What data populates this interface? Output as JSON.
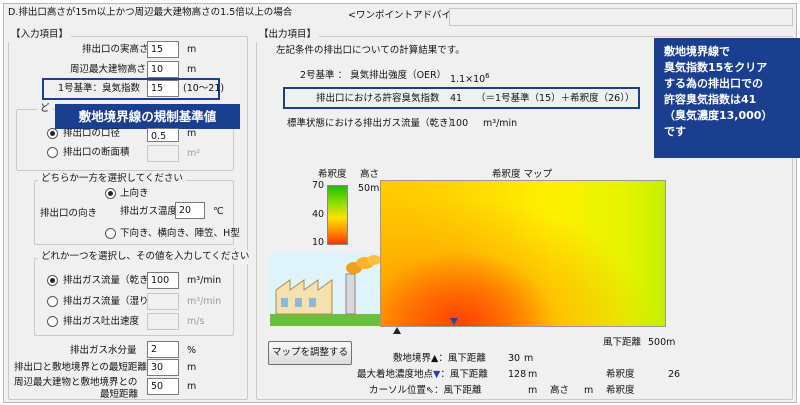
{
  "window": {
    "title": "D.排出口高さが15m以上かつ周辺最大建物高さの1.5倍以上の場合",
    "advice_label": "<ワンポイントアドバイス>"
  },
  "input_section": {
    "title": "【入力項目】",
    "outlet_height": {
      "label": "排出口の実高さ",
      "value": "15",
      "unit": "m"
    },
    "building_height": {
      "label": "周辺最大建物高さ",
      "value": "10",
      "unit": "m"
    },
    "standard1": {
      "label": "1号基準：臭気指数",
      "value": "15",
      "range": "(10〜21)"
    },
    "shape_group": {
      "title_partial": "ど",
      "option_diameter": "排出口の口径",
      "diameter_value": "0.5",
      "diameter_unit": "m",
      "option_area": "排出口の断面積",
      "area_unit": "m²"
    },
    "direction_group": {
      "title": "どちらか一方を選択してください",
      "label": "排出口の向き",
      "option_up": "上向き",
      "temp_label": "排出ガス温度",
      "temp_value": "20",
      "temp_unit": "℃",
      "option_other": "下向き、横向き、陣笠、H型"
    },
    "flow_group": {
      "title": "どれか一つを選択し、その値を入力してください",
      "option_dry": "排出ガス流量（乾き）",
      "dry_value": "100",
      "dry_unit": "m³/min",
      "option_wet": "排出ガス流量（湿り）",
      "wet_unit": "m³/min",
      "option_velocity": "排出ガス吐出速度",
      "velocity_unit": "m/s"
    },
    "moisture": {
      "label": "排出ガス水分量",
      "value": "2",
      "unit": "%"
    },
    "boundary_distance": {
      "label": "排出口と敷地境界との最短距離",
      "value": "30",
      "unit": "m"
    },
    "building_boundary_distance": {
      "label1": "周辺最大建物と敷地境界との",
      "label2": "最短距離",
      "value": "50",
      "unit": "m"
    }
  },
  "output_section": {
    "title": "【出力項目】",
    "intro": "左記条件の排出口についての計算結果です。",
    "oer_label": "2号基準 ： 臭気排出強度（OER）",
    "oer_value": "1.1×10",
    "oer_exp": "6",
    "allowed_label": "排出口における許容臭気指数",
    "allowed_value": "41",
    "allowed_note": "（＝1号基準（15）＋希釈度（26））",
    "flow_label": "標準状態における排出ガス流量（乾き）",
    "flow_value": "100",
    "flow_unit": "m³/min"
  },
  "map": {
    "title": "希釈度 マップ",
    "legend_title": "希釈度",
    "legend_ticks": [
      "70",
      "40",
      "10"
    ],
    "height_label": "高さ",
    "height_value": "50m",
    "distance_label": "風下距離",
    "distance_value": "500m",
    "colors": {
      "low": "#ff4a00",
      "mid": "#ffd400",
      "high": "#1fbf00"
    }
  },
  "adjust_button": "マップを調整する",
  "readouts": {
    "boundary_label": "敷地境界",
    "boundary_text": "：風下距離",
    "boundary_value": "30",
    "boundary_unit": "m",
    "maxpoint_label": "最大着地濃度地点",
    "maxpoint_text": "：風下距離",
    "maxpoint_value": "128",
    "maxpoint_unit": "m",
    "maxpoint_dilution_label": "希釈度",
    "maxpoint_dilution_value": "26",
    "cursor_label": "カーソル位置",
    "cursor_text": "：風下距離",
    "cursor_unit": "m",
    "cursor_height": "高さ",
    "cursor_height_unit": "m",
    "cursor_dilution": "希釈度"
  },
  "callouts": {
    "left": "敷地境界線の規制基準値",
    "right": [
      "敷地境界線で",
      "臭気指数15をクリア",
      "する為の排出口での",
      "許容臭気指数は41",
      "（臭気濃度13,000）",
      "です"
    ]
  }
}
